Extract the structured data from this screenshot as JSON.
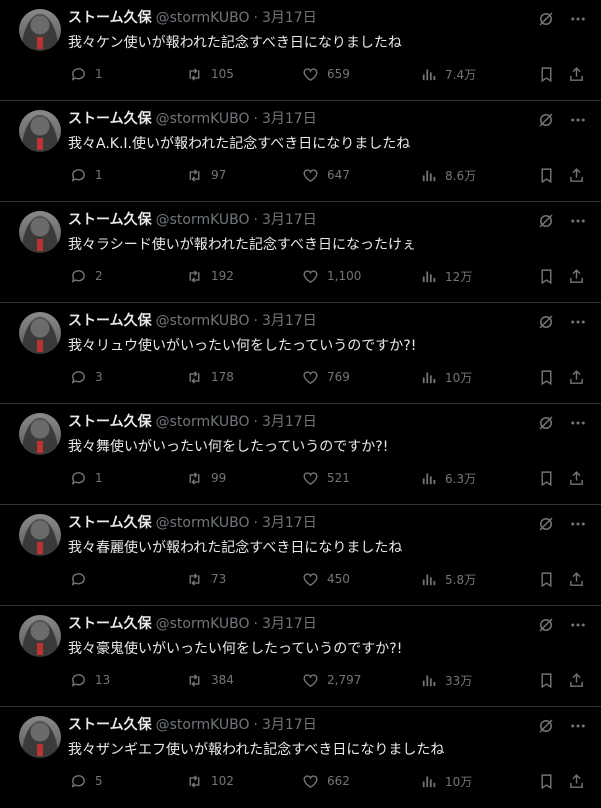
{
  "author": {
    "name": "ストーム久保",
    "handle": "@stormKUBO",
    "date": "3月17日"
  },
  "tweets": [
    {
      "text": "我々ケン使いが報われた記念すべき日になりましたね",
      "replies": "1",
      "retweets": "105",
      "likes": "659",
      "views": "7.4万"
    },
    {
      "text": "我々A.K.I.使いが報われた記念すべき日になりましたね",
      "replies": "1",
      "retweets": "97",
      "likes": "647",
      "views": "8.6万"
    },
    {
      "text": "我々ラシード使いが報われた記念すべき日になったけぇ",
      "replies": "2",
      "retweets": "192",
      "likes": "1,100",
      "views": "12万"
    },
    {
      "text": "我々リュウ使いがいったい何をしたっていうのですか?!",
      "replies": "3",
      "retweets": "178",
      "likes": "769",
      "views": "10万"
    },
    {
      "text": "我々舞使いがいったい何をしたっていうのですか?!",
      "replies": "1",
      "retweets": "99",
      "likes": "521",
      "views": "6.3万"
    },
    {
      "text": "我々春麗使いが報われた記念すべき日になりましたね",
      "replies": "",
      "retweets": "73",
      "likes": "450",
      "views": "5.8万"
    },
    {
      "text": "我々豪鬼使いがいったい何をしたっていうのですか?!",
      "replies": "13",
      "retweets": "384",
      "likes": "2,797",
      "views": "33万"
    },
    {
      "text": "我々ザンギエフ使いが報われた記念すべき日になりましたね",
      "replies": "5",
      "retweets": "102",
      "likes": "662",
      "views": "10万"
    }
  ]
}
